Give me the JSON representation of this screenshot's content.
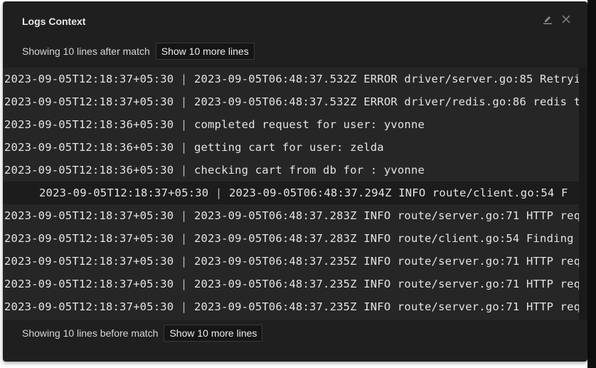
{
  "dialog": {
    "title": "Logs Context",
    "icons": {
      "edit": "pencil-icon",
      "close": "close-icon"
    }
  },
  "after": {
    "label": "Showing 10 lines after match",
    "button": "Show 10 more lines"
  },
  "before": {
    "label": "Showing 10 lines before match",
    "button": "Show 10 more lines"
  },
  "separator": "|",
  "logs": [
    {
      "ts": "2023-09-05T12:18:37+05:30",
      "msg": "2023-09-05T06:48:37.532Z ERROR driver/server.go:85 Retryi"
    },
    {
      "ts": "2023-09-05T12:18:37+05:30",
      "msg": "2023-09-05T06:48:37.532Z ERROR driver/redis.go:86 redis t"
    },
    {
      "ts": "2023-09-05T12:18:36+05:30",
      "msg": "completed request for user: yvonne"
    },
    {
      "ts": "2023-09-05T12:18:36+05:30",
      "msg": "getting cart for user: zelda"
    },
    {
      "ts": "2023-09-05T12:18:36+05:30",
      "msg": "checking cart from db for : yvonne"
    },
    {
      "ts": "2023-09-05T12:18:37+05:30",
      "msg": "2023-09-05T06:48:37.294Z INFO route/client.go:54 F",
      "match": true
    },
    {
      "ts": "2023-09-05T12:18:37+05:30",
      "msg": "2023-09-05T06:48:37.283Z INFO route/server.go:71 HTTP req"
    },
    {
      "ts": "2023-09-05T12:18:37+05:30",
      "msg": "2023-09-05T06:48:37.283Z INFO route/client.go:54 Finding"
    },
    {
      "ts": "2023-09-05T12:18:37+05:30",
      "msg": "2023-09-05T06:48:37.235Z INFO route/server.go:71 HTTP req"
    },
    {
      "ts": "2023-09-05T12:18:37+05:30",
      "msg": "2023-09-05T06:48:37.235Z INFO route/server.go:71 HTTP req"
    },
    {
      "ts": "2023-09-05T12:18:37+05:30",
      "msg": "2023-09-05T06:48:37.235Z INFO route/server.go:71 HTTP req"
    }
  ]
}
